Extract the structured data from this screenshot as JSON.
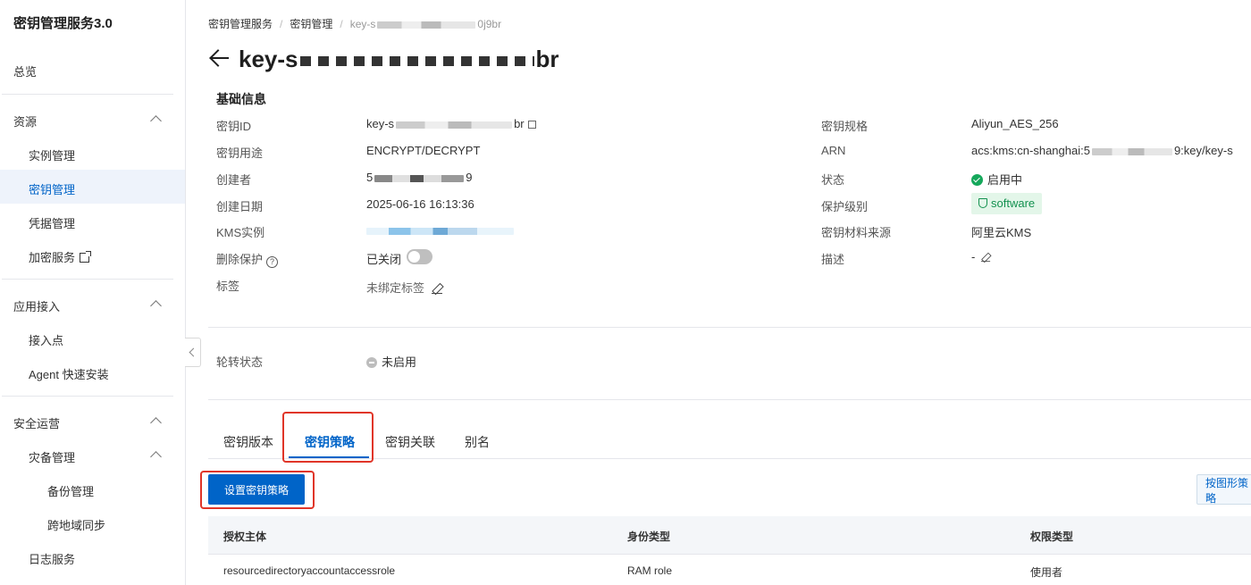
{
  "sidebar": {
    "title": "密钥管理服务3.0",
    "overview": "总览",
    "groups": {
      "resources": {
        "label": "资源",
        "items": [
          "实例管理",
          "密钥管理",
          "凭据管理",
          "加密服务"
        ]
      },
      "access": {
        "label": "应用接入",
        "items": [
          "接入点",
          "Agent 快速安装"
        ]
      },
      "security": {
        "label": "安全运营",
        "disaster": "灾备管理",
        "disaster_items": [
          "备份管理",
          "跨地域同步"
        ],
        "log": "日志服务"
      }
    },
    "active_item": "密钥管理"
  },
  "breadcrumb": [
    "密钥管理服务",
    "密钥管理",
    "key-s",
    "0j9br"
  ],
  "page": {
    "title_prefix": "key-s",
    "title_suffix": "br"
  },
  "basic_info": {
    "title": "基础信息",
    "left": {
      "key_id_label": "密钥ID",
      "key_id_value_prefix": "key-s",
      "key_id_value_suffix": "br",
      "usage_label": "密钥用途",
      "usage_value": "ENCRYPT/DECRYPT",
      "creator_label": "创建者",
      "creator_value_prefix": "5",
      "creator_value_suffix": "9",
      "created_label": "创建日期",
      "created_value": "2025-06-16 16:13:36",
      "kms_label": "KMS实例",
      "delete_label": "删除保护",
      "delete_value": "已关闭",
      "tags_label": "标签",
      "tags_value": "未绑定标签"
    },
    "right": {
      "spec_label": "密钥规格",
      "spec_value": "Aliyun_AES_256",
      "arn_label": "ARN",
      "arn_value_prefix": "acs:kms:cn-shanghai:5",
      "arn_value_suffix": "9:key/key-s",
      "status_label": "状态",
      "status_value": "启用中",
      "protection_label": "保护级别",
      "protection_value": "software",
      "material_label": "密钥材料来源",
      "material_value": "阿里云KMS",
      "desc_label": "描述",
      "desc_value": "-"
    }
  },
  "rotation": {
    "label": "轮转状态",
    "value": "未启用"
  },
  "tabs": [
    "密钥版本",
    "密钥策略",
    "密钥关联",
    "别名"
  ],
  "active_tab": "密钥策略",
  "actions": {
    "set_policy": "设置密钥策略",
    "graph_policy": "按图形策略"
  },
  "table": {
    "headers": [
      "授权主体",
      "身份类型",
      "权限类型"
    ],
    "rows": [
      [
        "resourcedirectoryaccountaccessrole",
        "RAM role",
        "使用者"
      ]
    ]
  },
  "colors": {
    "primary": "#0064c8",
    "success": "#15a85b",
    "highlight": "#e03528"
  }
}
